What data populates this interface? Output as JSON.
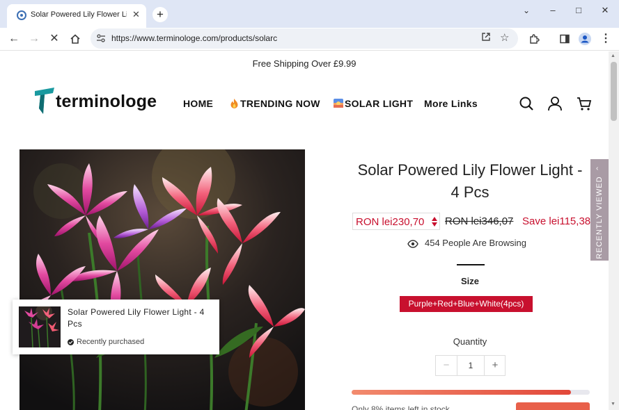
{
  "browser": {
    "tab_title": "Solar Powered Lily Flower Light",
    "url": "https://www.terminologe.com/products/solarc",
    "controls": {
      "minimize": "–",
      "maximize": "□",
      "close": "✕",
      "chevron": "⌄"
    }
  },
  "announcement": "Free Shipping Over £9.99",
  "header": {
    "logo_text": "terminologe",
    "menu": [
      {
        "label": "HOME",
        "prefix": ""
      },
      {
        "label": "TRENDING NOW",
        "prefix": "🔥"
      },
      {
        "label": "SOLAR LIGHT",
        "prefix": "🌅"
      },
      {
        "label": "More Links",
        "prefix": ""
      }
    ],
    "icons": [
      "search-icon",
      "account-icon",
      "cart-icon"
    ]
  },
  "product": {
    "title": "Solar Powered Lily Flower Light - 4 Pcs",
    "price_current": "RON lei230,70",
    "price_compare": "RON lei346,07",
    "price_save": "Save lei115,38",
    "browsing": "454 People Are Browsing",
    "size_label": "Size",
    "selected_variant": "Purple+Red+Blue+White(4pcs)",
    "quantity_label": "Quantity",
    "quantity_value": "1",
    "stock_fill_fraction": 0.92,
    "stock_text": "Only 8% items left in stock"
  },
  "recently_viewed": {
    "label": "RECENTLY VIEWED"
  },
  "popup": {
    "title": "Solar Powered Lily Flower Light - 4 Pcs",
    "status": "Recently purchased"
  },
  "colors": {
    "accent_red": "#c8102e",
    "side_tab": "#a99ba5",
    "chrome_bg": "#dfe6f5"
  }
}
